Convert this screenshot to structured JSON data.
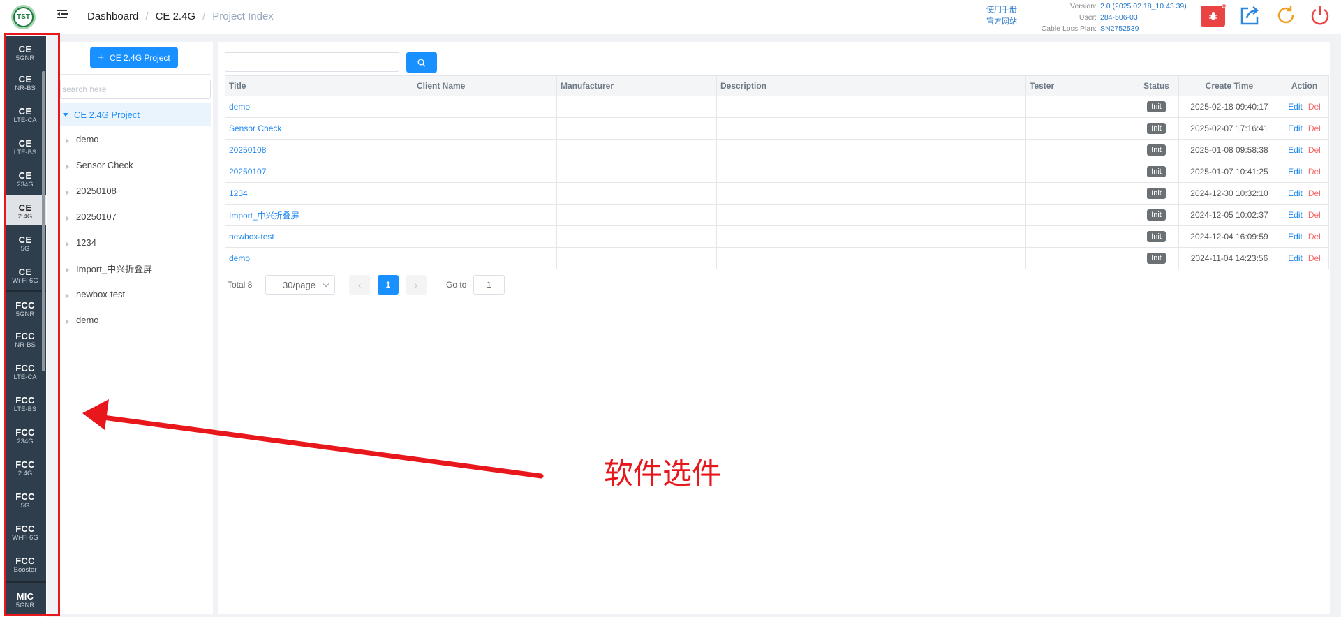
{
  "header": {
    "logo_text": "TST",
    "breadcrumb": [
      "Dashboard",
      "CE 2.4G",
      "Project Index"
    ],
    "help_links": [
      "使用手册",
      "官方网站"
    ],
    "info": [
      {
        "key": "Version:",
        "value": "2.0 (2025.02.18_10.43.39)"
      },
      {
        "key": "User:",
        "value": "284-506-03"
      },
      {
        "key": "Cable Loss Plan:",
        "value": "SN2752539"
      }
    ],
    "icons": [
      "bug-icon",
      "export-icon",
      "refresh-icon",
      "power-icon"
    ],
    "colors": {
      "bug_button": "#e94343",
      "export": "#2e86de",
      "refresh": "#f0a020",
      "power": "#e94343"
    }
  },
  "sidebar": {
    "items": [
      {
        "t1": "CE",
        "t2": "5GNR"
      },
      {
        "t1": "CE",
        "t2": "NR-BS"
      },
      {
        "t1": "CE",
        "t2": "LTE-CA"
      },
      {
        "t1": "CE",
        "t2": "LTE-BS"
      },
      {
        "t1": "CE",
        "t2": "234G"
      },
      {
        "t1": "CE",
        "t2": "2.4G",
        "active": true
      },
      {
        "t1": "CE",
        "t2": "5G"
      },
      {
        "t1": "CE",
        "t2": "Wi-Fi 6G"
      },
      {
        "t1": "FCC",
        "t2": "5GNR"
      },
      {
        "t1": "FCC",
        "t2": "NR-BS"
      },
      {
        "t1": "FCC",
        "t2": "LTE-CA"
      },
      {
        "t1": "FCC",
        "t2": "LTE-BS"
      },
      {
        "t1": "FCC",
        "t2": "234G"
      },
      {
        "t1": "FCC",
        "t2": "2.4G"
      },
      {
        "t1": "FCC",
        "t2": "5G"
      },
      {
        "t1": "FCC",
        "t2": "Wi-Fi 6G"
      },
      {
        "t1": "FCC",
        "t2": "Booster"
      },
      {
        "t1": "MIC",
        "t2": "5GNR"
      }
    ]
  },
  "tree": {
    "add_button": "CE 2.4G Project",
    "search_placeholder": "search here",
    "root": "CE 2.4G Project",
    "nodes": [
      "demo",
      "Sensor Check",
      "20250108",
      "20250107",
      "1234",
      "Import_中兴折叠屏",
      "newbox-test",
      "demo"
    ]
  },
  "table": {
    "columns": [
      "Title",
      "Client Name",
      "Manufacturer",
      "Description",
      "Tester",
      "Status",
      "Create Time",
      "Action"
    ],
    "rows": [
      {
        "title": "demo",
        "client": "",
        "manufacturer": "",
        "description": "",
        "tester": "",
        "status": "Init",
        "time": "2025-02-18 09:40:17"
      },
      {
        "title": "Sensor Check",
        "client": "",
        "manufacturer": "",
        "description": "",
        "tester": "",
        "status": "Init",
        "time": "2025-02-07 17:16:41"
      },
      {
        "title": "20250108",
        "client": "",
        "manufacturer": "",
        "description": "",
        "tester": "",
        "status": "Init",
        "time": "2025-01-08 09:58:38"
      },
      {
        "title": "20250107",
        "client": "",
        "manufacturer": "",
        "description": "",
        "tester": "",
        "status": "Init",
        "time": "2025-01-07 10:41:25"
      },
      {
        "title": "1234",
        "client": "",
        "manufacturer": "",
        "description": "",
        "tester": "",
        "status": "Init",
        "time": "2024-12-30 10:32:10"
      },
      {
        "title": "Import_中兴折叠屏",
        "client": "",
        "manufacturer": "",
        "description": "",
        "tester": "",
        "status": "Init",
        "time": "2024-12-05 10:02:37"
      },
      {
        "title": "newbox-test",
        "client": "",
        "manufacturer": "",
        "description": "",
        "tester": "",
        "status": "Init",
        "time": "2024-12-04 16:09:59"
      },
      {
        "title": "demo",
        "client": "",
        "manufacturer": "",
        "description": "",
        "tester": "",
        "status": "Init",
        "time": "2024-11-04 14:23:56"
      }
    ],
    "edit_label": "Edit",
    "del_label": "Del"
  },
  "pagination": {
    "total": "Total 8",
    "page_size": "30/page",
    "current_page": "1",
    "goto_label": "Go to",
    "goto_value": "1"
  },
  "annotation": {
    "text": "软件选件",
    "color": "#e8171b"
  }
}
